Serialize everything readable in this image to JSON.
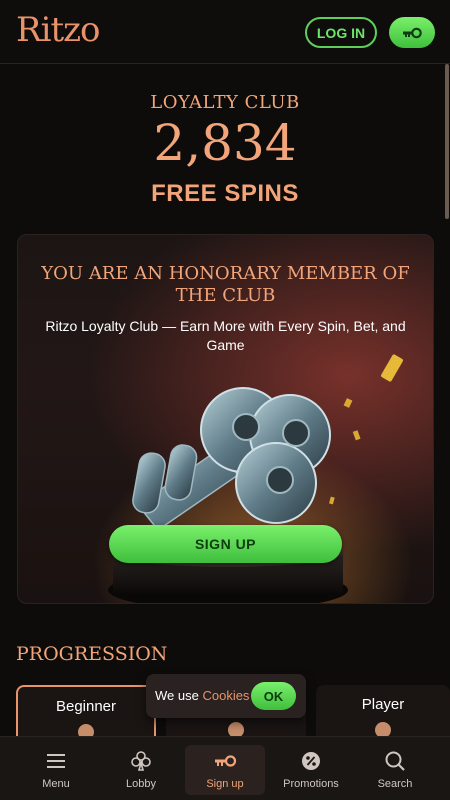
{
  "header": {
    "logo": "Ritzo",
    "login_label": "LOG IN",
    "key_icon": "key-icon"
  },
  "loyalty": {
    "label": "LOYALTY CLUB",
    "count": "2,834",
    "unit": "FREE SPINS"
  },
  "promo": {
    "title": "YOU ARE AN HONORARY MEMBER OF THE CLUB",
    "subtitle": "Ritzo Loyalty Club — Earn More with Every Spin, Bet, and Game",
    "cta_label": "SIGN UP"
  },
  "progression": {
    "title": "PROGRESSION",
    "tiers": [
      {
        "name": "Beginner",
        "active": true
      },
      {
        "name": "",
        "active": false
      },
      {
        "name": "Player",
        "active": false
      }
    ]
  },
  "cookie": {
    "text": "We use",
    "link": "Cookies",
    "ok_label": "OK"
  },
  "bottom_nav": {
    "items": [
      {
        "label": "Menu",
        "icon": "menu-icon"
      },
      {
        "label": "Lobby",
        "icon": "club-icon"
      },
      {
        "label": "Sign up",
        "icon": "key-icon",
        "active": true
      },
      {
        "label": "Promotions",
        "icon": "promotions-icon"
      },
      {
        "label": "Search",
        "icon": "search-icon"
      }
    ]
  },
  "colors": {
    "accent": "#f2a57a",
    "primary_green": "#5ed05a",
    "background": "#0e0c0b"
  }
}
